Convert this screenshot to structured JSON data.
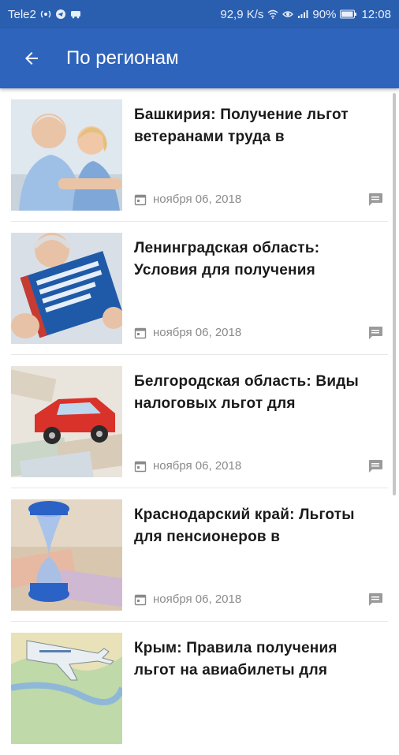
{
  "statusbar": {
    "carrier": "Tele2",
    "speed": "92,9 K/s",
    "battery": "90%",
    "time": "12:08"
  },
  "appbar": {
    "title": "По регионам"
  },
  "articles": [
    {
      "title": "Башкирия: Получение льгот ветеранами труда в",
      "date": "ноября 06, 2018",
      "image": "elderly-couple"
    },
    {
      "title": "Ленинградская область: Условия для получения",
      "date": "ноября 06, 2018",
      "image": "tax-code-book"
    },
    {
      "title": "Белгородская область: Виды налоговых льгот для",
      "date": "ноября 06, 2018",
      "image": "red-car-money"
    },
    {
      "title": "Краснодарский край: Льготы для пенсионеров в",
      "date": "ноября 06, 2018",
      "image": "hourglass-money"
    },
    {
      "title": "Крым: Правила получения льгот на авиабилеты для",
      "date": "",
      "image": "airplane-map"
    }
  ],
  "colors": {
    "statusbar": "#2a5fb0",
    "appbar": "#2f64bd",
    "meta_text": "#8a8a8a"
  }
}
